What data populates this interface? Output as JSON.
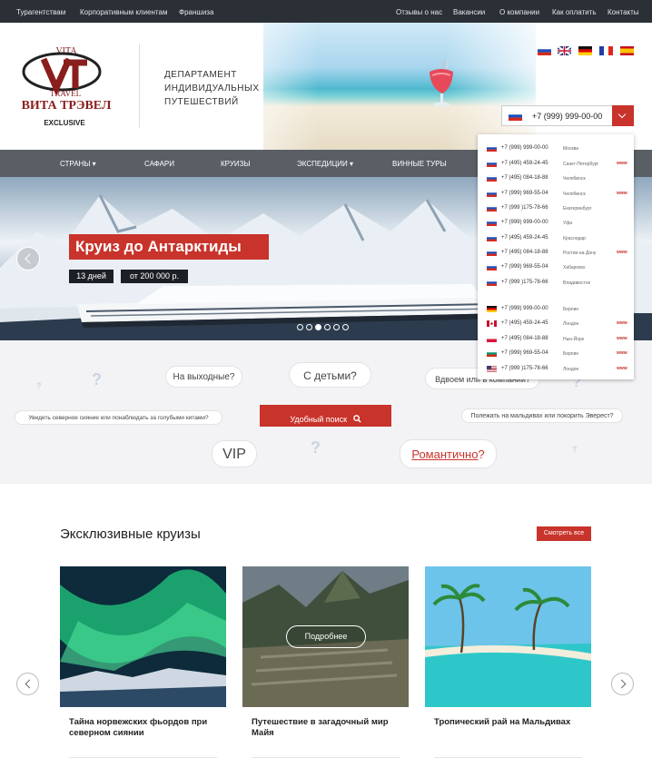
{
  "topbar": {
    "left": [
      "Турагентствам",
      "Корпоративным клиентам",
      "Франшиза"
    ],
    "right": [
      "Отзывы о нас",
      "Вакансии",
      "О компании",
      "Как оплатить",
      "Контакты"
    ]
  },
  "logo": {
    "brand_top": "VITA",
    "brand_mid": "TRAVEL",
    "brand_name": "ВИТА ТРЭВЕЛ",
    "sub": "EXCLUSIVE"
  },
  "department": "ДЕПАРТАМЕНТ ИНДИВИДУАЛЬНЫХ ПУТЕШЕСТВИЙ",
  "languages": [
    "ru",
    "en",
    "de",
    "fr",
    "es"
  ],
  "phone": {
    "number": "+7 (999) 999-00-00",
    "flag": "ru"
  },
  "phones_dropdown": [
    {
      "flag": "ru",
      "phone": "+7 (999) 999-00-00",
      "city": "Москва",
      "www": ""
    },
    {
      "flag": "ru",
      "phone": "+7 (495) 459-24-45",
      "city": "Санкт-Петербург",
      "www": "www"
    },
    {
      "flag": "ru",
      "phone": "+7 (495) 084-18-88",
      "city": "Челябинск",
      "www": ""
    },
    {
      "flag": "ru",
      "phone": "+7 (999) 969-55-04",
      "city": "Челябинск",
      "www": "www"
    },
    {
      "flag": "ru",
      "phone": "+7 (999 )175-78-66",
      "city": "Екатеринбург",
      "www": ""
    },
    {
      "flag": "ru",
      "phone": "+7 (999) 999-00-00",
      "city": "Уфа",
      "www": ""
    },
    {
      "flag": "ru",
      "phone": "+7 (495) 459-24-45",
      "city": "Краснодар",
      "www": ""
    },
    {
      "flag": "ru",
      "phone": "+7 (495) 084-18-88",
      "city": "Ростов-на-Дону",
      "www": "www"
    },
    {
      "flag": "ru",
      "phone": "+7 (999) 969-55-04",
      "city": "Хабаровск",
      "www": ""
    },
    {
      "flag": "ru",
      "phone": "+7 (999 )175-78-66",
      "city": "Владивосток",
      "www": ""
    },
    {
      "flag": "de",
      "phone": "+7 (999) 999-00-00",
      "city": "Берлин",
      "www": ""
    },
    {
      "flag": "ca",
      "phone": "+7 (495) 459-24-45",
      "city": "Лондон",
      "www": "www"
    },
    {
      "flag": "pl",
      "phone": "+7 (495) 084-18-88",
      "city": "Нью-Йорк",
      "www": "www"
    },
    {
      "flag": "bg",
      "phone": "+7 (999) 969-55-04",
      "city": "Берлин",
      "www": "www"
    },
    {
      "flag": "us",
      "phone": "+7 (999 )175-78-66",
      "city": "Лондон",
      "www": "www"
    }
  ],
  "nav": [
    "СТРАНЫ",
    "САФАРИ",
    "КРУИЗЫ",
    "ЭКСПЕДИЦИИ",
    "ВИННЫЕ ТУРЫ"
  ],
  "hero": {
    "title": "Круиз до Антарктиды",
    "days": "13 дней",
    "price": "от 200 000 р.",
    "slides": 6,
    "active_slide": 2
  },
  "search": {
    "bubbles": [
      "На выходные?",
      "С детьми?",
      "Вдвоем или в компании?",
      "Увидеть северное сияние или понаблюдать за голубыми китами?",
      "Полежать на мальдивах или покорить Эверест?",
      "VIP",
      "Романтично?"
    ],
    "link_word": "Романтично",
    "button": "Удобный поиск"
  },
  "section": {
    "title": "Эксклюзивные круизы",
    "see_all": "Смотреть все"
  },
  "cards": [
    {
      "title": "Тайна норвежских фьордов при северном сиянии"
    },
    {
      "title": "Путешествие в загадочный мир Майя",
      "button": "Подробнее"
    },
    {
      "title": "Тропический рай на Мальдивах"
    }
  ],
  "colors": {
    "accent": "#c8332b",
    "topbar": "#2b2f36",
    "nav": "#5a5f66"
  }
}
